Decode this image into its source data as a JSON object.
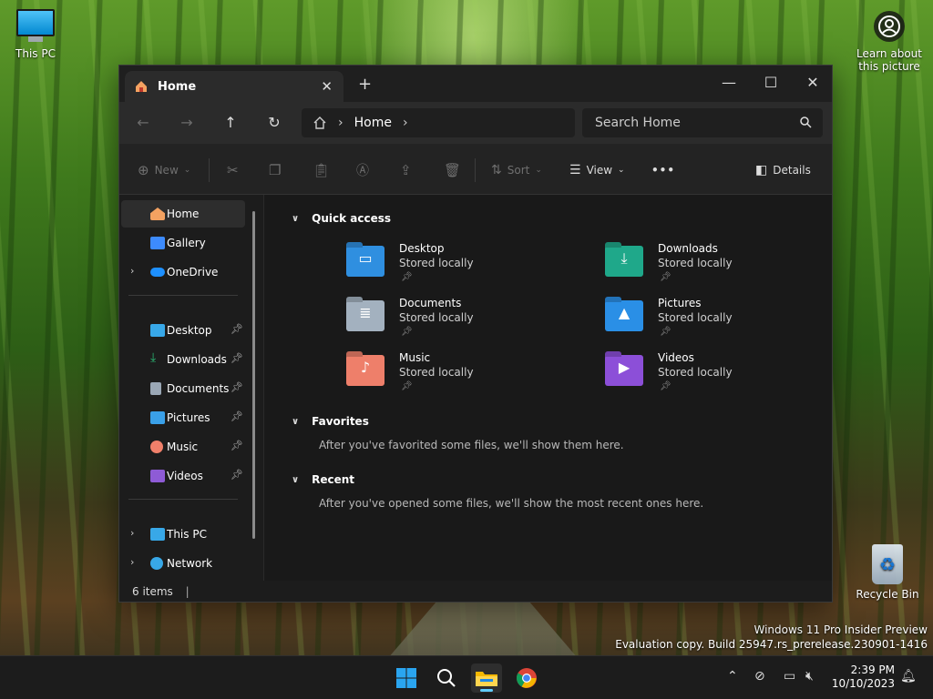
{
  "desktop": {
    "this_pc_label": "This PC",
    "learn_label_1": "Learn about",
    "learn_label_2": "this picture",
    "recycle_label": "Recycle Bin",
    "watermark_1": "Windows 11 Pro Insider Preview",
    "watermark_2": "Evaluation copy. Build 25947.rs_prerelease.230901-1416"
  },
  "window": {
    "tab_title": "Home",
    "new_tab": "+",
    "minimize": "—",
    "maximize": "☐",
    "close": "✕"
  },
  "nav": {
    "back": "←",
    "forward": "→",
    "up": "↑",
    "refresh": "↻",
    "breadcrumb_current": "Home",
    "search_placeholder": "Search Home"
  },
  "commands": {
    "new_label": "New",
    "sort_label": "Sort",
    "view_label": "View",
    "more_label": "•••",
    "details_label": "Details"
  },
  "sidebar": {
    "items": [
      {
        "label": "Home",
        "color": "#f4a261"
      },
      {
        "label": "Gallery",
        "color": "#3d8bfd"
      },
      {
        "label": "OneDrive",
        "color": "#1e90ff"
      },
      {
        "label": "Desktop",
        "color": "#38a8e8"
      },
      {
        "label": "Downloads",
        "color": "#2bb673"
      },
      {
        "label": "Documents",
        "color": "#9aa7b5"
      },
      {
        "label": "Pictures",
        "color": "#3aa0e8"
      },
      {
        "label": "Music",
        "color": "#f0806a"
      },
      {
        "label": "Videos",
        "color": "#8e5bd6"
      },
      {
        "label": "This PC",
        "color": "#38a8e8"
      },
      {
        "label": "Network",
        "color": "#38a8e8"
      }
    ]
  },
  "main": {
    "quick_access_title": "Quick access",
    "favorites_title": "Favorites",
    "favorites_empty": "After you've favorited some files, we'll show them here.",
    "recent_title": "Recent",
    "recent_empty": "After you've opened some files, we'll show the most recent ones here.",
    "folders": [
      {
        "name": "Desktop",
        "sub": "Stored locally",
        "color": "#2f8fe0",
        "glyph": "▭"
      },
      {
        "name": "Downloads",
        "sub": "Stored locally",
        "color": "#1fa88a",
        "glyph": "⤓"
      },
      {
        "name": "Documents",
        "sub": "Stored locally",
        "color": "#a3b1bf",
        "glyph": "≣"
      },
      {
        "name": "Pictures",
        "sub": "Stored locally",
        "color": "#2a8fe6",
        "glyph": "▲"
      },
      {
        "name": "Music",
        "sub": "Stored locally",
        "color": "#ee7f6a",
        "glyph": "♪"
      },
      {
        "name": "Videos",
        "sub": "Stored locally",
        "color": "#8c4fd8",
        "glyph": "▶"
      }
    ]
  },
  "status": {
    "items_count": "6 items"
  },
  "taskbar": {
    "time": "2:39 PM",
    "date": "10/10/2023"
  }
}
